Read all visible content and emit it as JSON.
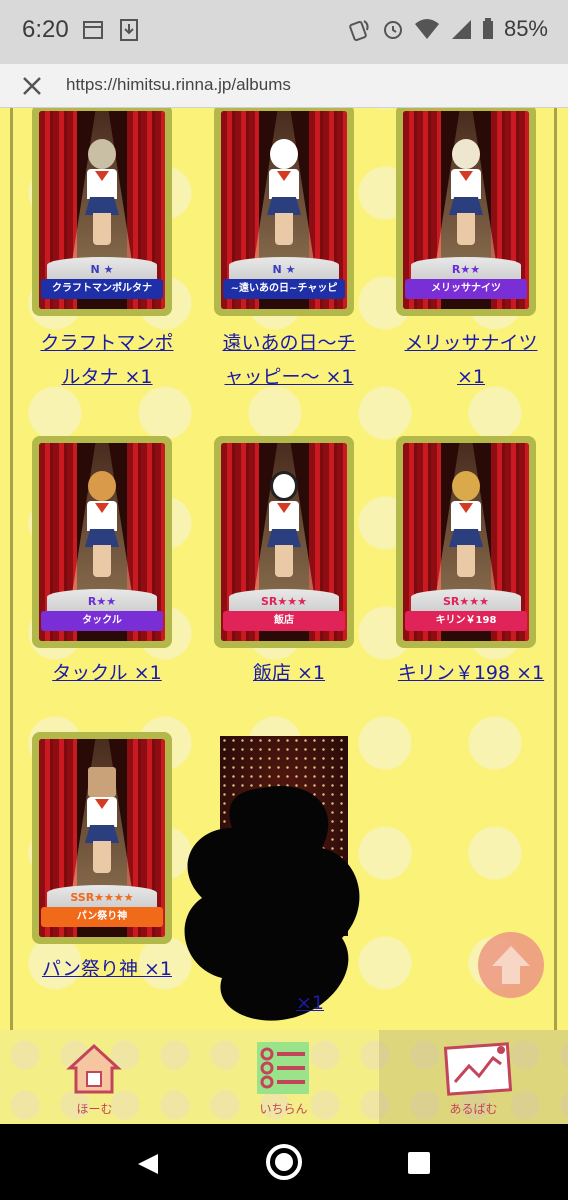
{
  "status_bar": {
    "time": "6:20",
    "battery": "85%"
  },
  "url_bar": {
    "url": "https://himitsu.rinna.jp/albums"
  },
  "cards": [
    {
      "rarity": "N ★",
      "ribbon": "クラフトマンポルタナ",
      "link_line1": "クラフトマンポ",
      "link_line2": "ルタナ ×1",
      "head_color": "#c8bfa5"
    },
    {
      "rarity": "N ★",
      "ribbon": "~遠いあの日~チャッピ",
      "link_line1": "遠いあの日～チ",
      "link_line2": "ャッピー～ ×1",
      "head_color": "#ffffff"
    },
    {
      "rarity": "R★★",
      "ribbon": "メリッサナイツ",
      "link_line1": "メリッサナイツ",
      "link_line2": "×1",
      "head_color": "#efe6cf"
    },
    {
      "rarity": "R★★",
      "ribbon": "タックル",
      "link_line1": "タックル ×1",
      "link_line2": "",
      "head_color": "#d99a4a"
    },
    {
      "rarity": "SR★★★",
      "ribbon": "飯店",
      "link_line1": "飯店 ×1",
      "link_line2": "",
      "head_color": "#ffffff"
    },
    {
      "rarity": "SR★★★",
      "ribbon": "キリン￥198",
      "link_line1": "キリン￥198 ×1",
      "link_line2": "",
      "head_color": "#d9a94a"
    },
    {
      "rarity": "SSR★★★★",
      "ribbon": "パン祭り神",
      "link_line1": "パン祭り神 ×1",
      "link_line2": "",
      "head_color": "#c9a27a"
    }
  ],
  "mystery_card": {
    "link_line1": "",
    "link_line2": "×1"
  },
  "bottom_nav": [
    {
      "label": "ほーむ",
      "icon": "house-icon"
    },
    {
      "label": "いちらん",
      "icon": "list-icon"
    },
    {
      "label": "あるばむ",
      "icon": "album-chart-icon"
    }
  ],
  "colors": {
    "background": "#fbf27a",
    "link": "#1a1aa8",
    "nav_label": "#c2455a"
  }
}
